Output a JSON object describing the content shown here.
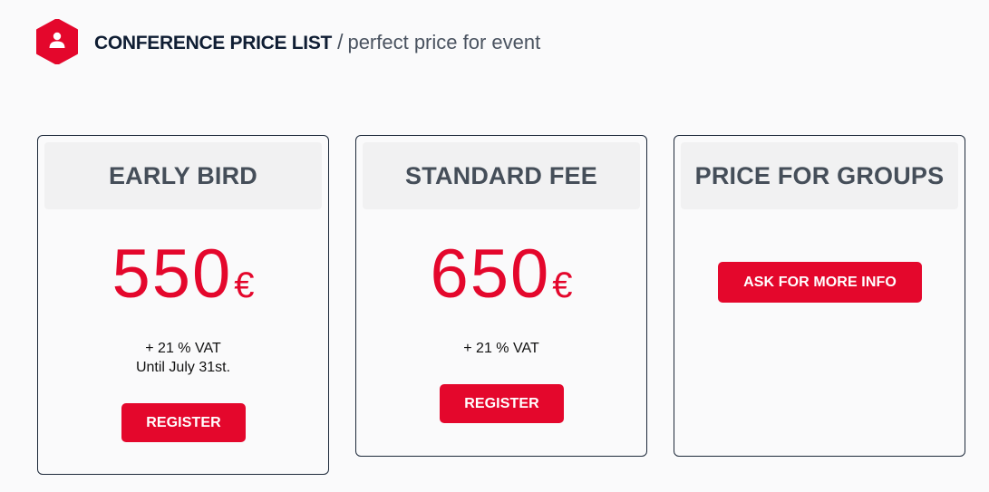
{
  "header": {
    "title": "CONFERENCE PRICE LIST",
    "separator": "/",
    "subtitle": "perfect price for event",
    "logo_icon": "user-hexagon-icon"
  },
  "colors": {
    "accent": "#e4072c",
    "heading": "#454e59",
    "border": "#1e2a3b",
    "background": "#fafafb"
  },
  "cards": [
    {
      "title": "EARLY BIRD",
      "price": "550",
      "currency": "€",
      "notes": [
        "+ 21 % VAT",
        "Until July 31st."
      ],
      "button": "REGISTER"
    },
    {
      "title": "STANDARD FEE",
      "price": "650",
      "currency": "€",
      "notes": [
        "+ 21 % VAT"
      ],
      "button": "REGISTER"
    },
    {
      "title": "PRICE FOR GROUPS",
      "button": "ASK FOR MORE INFO"
    }
  ]
}
